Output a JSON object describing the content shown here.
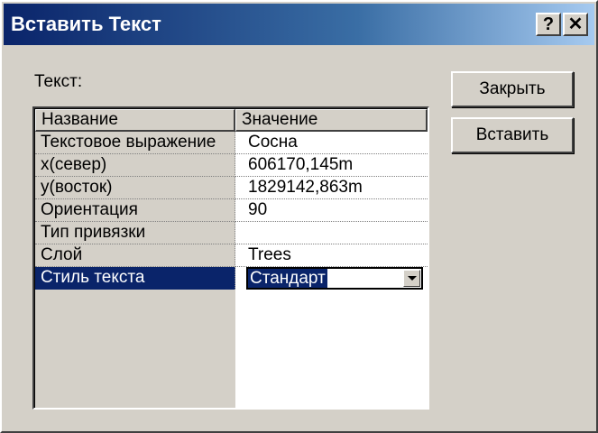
{
  "window": {
    "title": "Вставить Текст",
    "help_glyph": "?",
    "close_glyph": "✕"
  },
  "text_label": "Текст:",
  "grid": {
    "columns": [
      "Название",
      "Значение"
    ],
    "rows": [
      {
        "name": "Текстовое выражение",
        "value": "Сосна"
      },
      {
        "name": "x(север)",
        "value": "606170,145m"
      },
      {
        "name": "y(восток)",
        "value": "1829142,863m"
      },
      {
        "name": "Ориентация",
        "value": "90"
      },
      {
        "name": "Тип привязки",
        "value": ""
      },
      {
        "name": "Слой",
        "value": "Trees"
      },
      {
        "name": "Стиль текста",
        "value": "Стандарт",
        "selected": true
      }
    ]
  },
  "buttons": {
    "close": "Закрыть",
    "insert": "Вставить"
  },
  "colors": {
    "title_bar_start": "#0a246a",
    "title_bar_end": "#a6caf0",
    "selection": "#0a246a",
    "face": "#d4d0c8"
  }
}
